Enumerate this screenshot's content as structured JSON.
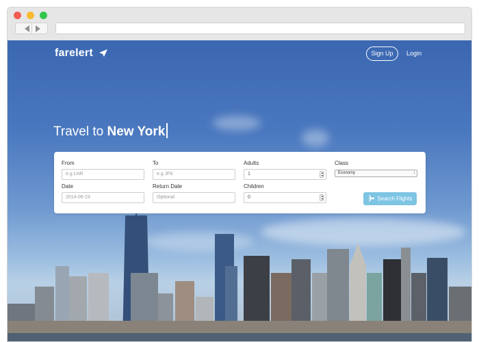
{
  "browser": {
    "title_bar_dots": [
      "close",
      "minimize",
      "maximize"
    ],
    "nav_icons": [
      "back-arrow-icon",
      "forward-arrow-icon"
    ],
    "url": ""
  },
  "site": {
    "logo": "farelert",
    "logo_icon": "paper-plane-icon",
    "nav": {
      "signup_label": "Sign Up",
      "login_label": "Login"
    }
  },
  "hero": {
    "headline_prefix": "Travel to",
    "headline_city": "New York"
  },
  "search_form": {
    "from": {
      "label": "From",
      "placeholder": "e.g LHR",
      "value": ""
    },
    "to": {
      "label": "To",
      "placeholder": "e.g JFK",
      "value": ""
    },
    "adults": {
      "label": "Adults",
      "value": "1"
    },
    "class": {
      "label": "Class",
      "selected": "Economy"
    },
    "date": {
      "label": "Date",
      "value": "2014-06-23"
    },
    "return_date": {
      "label": "Return Date",
      "placeholder": "Optional",
      "value": ""
    },
    "children": {
      "label": "Children",
      "value": "0"
    },
    "submit_label": "Search Flights",
    "submit_icon": "airplane-icon"
  },
  "colors": {
    "accent_button": "#7ec4e3",
    "sky_top": "#3b67b1",
    "text_on_sky": "#ffffff"
  }
}
